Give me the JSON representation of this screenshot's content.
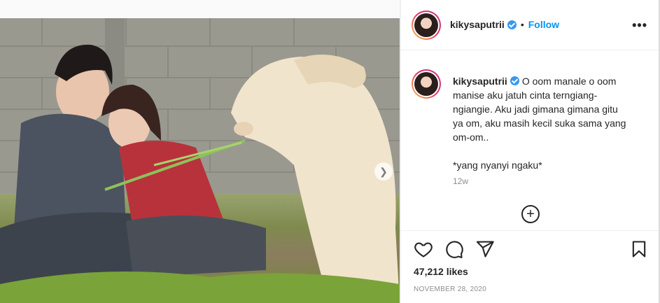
{
  "post": {
    "username": "kikysaputrii",
    "follow_label": "Follow",
    "more_label": "•••",
    "caption_lines": [
      "O oom manale o oom",
      "manise aku jatuh cinta terngiang-",
      "ngiangie. Aku jadi gimana gimana gitu",
      "ya om, aku masih kecil suka sama yang",
      "om-om.."
    ],
    "caption_footer": "*yang nyanyi ngaku*",
    "time_ago": "12w",
    "likes": "47,212 likes",
    "date": "NOVEMBER 28, 2020"
  },
  "colors": {
    "accent": "#0095f6",
    "verified": "#3897f0",
    "muted": "#8e8e8e"
  },
  "icons": {
    "like": "heart-icon",
    "comment": "comment-icon",
    "share": "paper-plane-icon",
    "save": "bookmark-icon",
    "add_comment": "plus-circle-icon",
    "carousel_next": "chevron-right-icon"
  }
}
